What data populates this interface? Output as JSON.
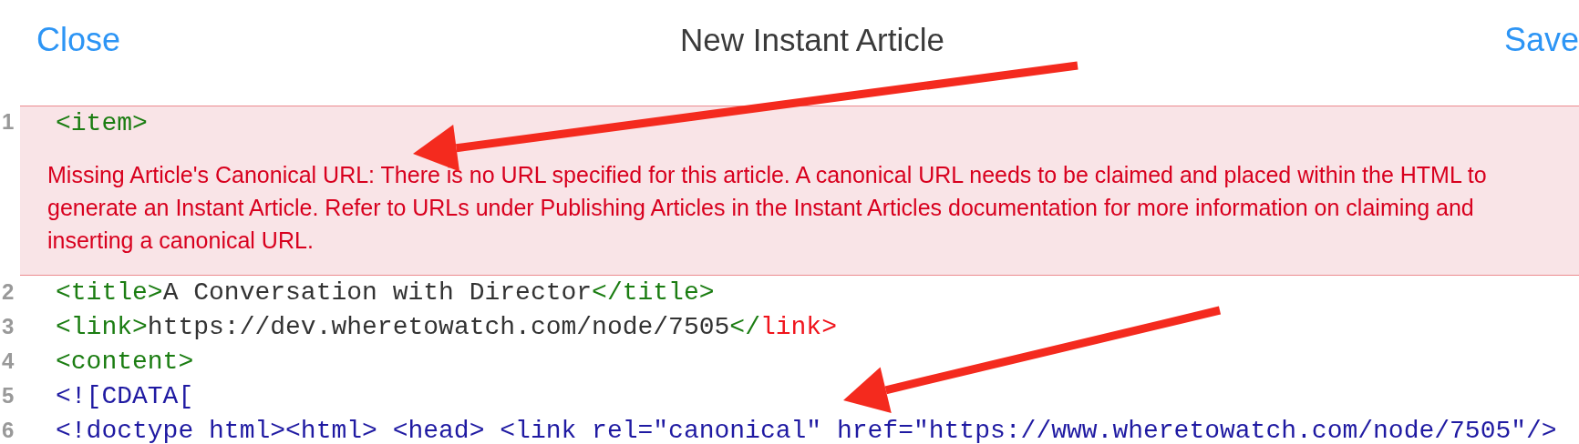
{
  "header": {
    "left_button": "Close",
    "title": "New Instant Article",
    "right_button": "Save"
  },
  "editor": {
    "lines": [
      {
        "number": "1",
        "error": true,
        "message": "Missing Article's Canonical URL: There is no URL specified for this article. A canonical URL needs to be claimed and placed within the HTML to generate an Instant Article. Refer to URLs under Publishing Articles in the Instant Articles documentation for more information on claiming and inserting a canonical URL.",
        "segments": [
          {
            "kind": "tag",
            "text": "<item>"
          }
        ]
      },
      {
        "number": "2",
        "error": false,
        "segments": [
          {
            "kind": "tag",
            "text": "<title>"
          },
          {
            "kind": "text",
            "text": "A Conversation with Director"
          },
          {
            "kind": "tag",
            "text": "</title>"
          }
        ]
      },
      {
        "number": "3",
        "error": false,
        "segments": [
          {
            "kind": "tag",
            "text": "<link>"
          },
          {
            "kind": "text",
            "text": "https://dev.wheretowatch.com/node/7505"
          },
          {
            "kind": "tag",
            "text": "</"
          },
          {
            "kind": "invalid",
            "text": "link>"
          }
        ]
      },
      {
        "number": "4",
        "error": false,
        "segments": [
          {
            "kind": "tag",
            "text": "<content>"
          }
        ]
      },
      {
        "number": "5",
        "error": false,
        "segments": [
          {
            "kind": "cdata",
            "text": "<![CDATA["
          }
        ]
      },
      {
        "number": "6",
        "error": false,
        "segments": [
          {
            "kind": "cdata",
            "text": "<!doctype html><html> <head> <link rel=\"canonical\" href=\"https://www.wheretowatch.com/node/7505\"/>"
          }
        ]
      }
    ]
  }
}
